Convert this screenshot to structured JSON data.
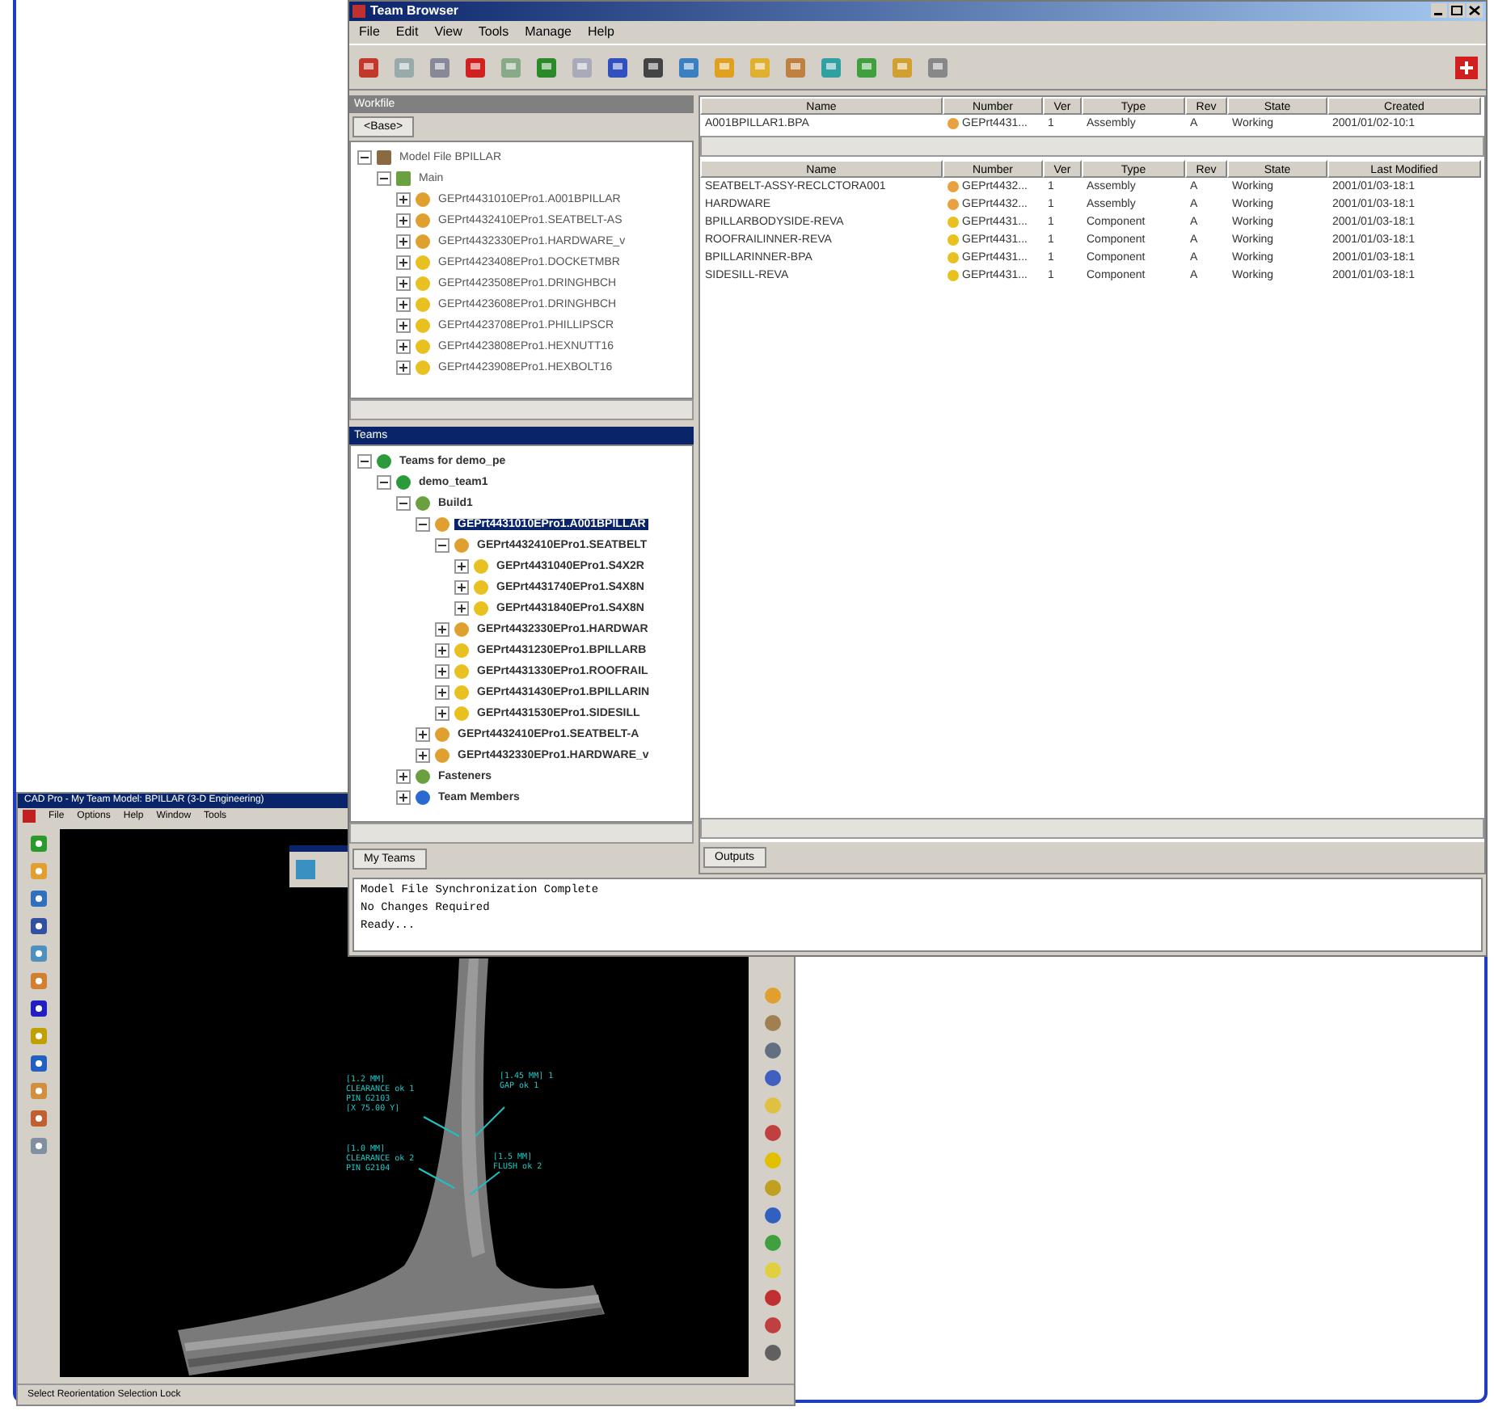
{
  "main_window": {
    "title": "Team Browser",
    "menu": [
      "File",
      "Edit",
      "View",
      "Tools",
      "Manage",
      "Help"
    ],
    "workfile": {
      "header": "Workfile",
      "tab": "<Base>",
      "tree": [
        {
          "label": "Model File BPILLAR",
          "kind": "model",
          "selected": false,
          "children": [
            {
              "label": "Main",
              "kind": "build",
              "selected": false,
              "children": [
                {
                  "label": "GEPrt4431010EPro1.A001BPILLAR",
                  "kind": "assembly",
                  "selected": false
                },
                {
                  "label": "GEPrt4432410EPro1.SEATBELT-AS",
                  "kind": "assembly",
                  "selected": false
                },
                {
                  "label": "GEPrt4432330EPro1.HARDWARE_v",
                  "kind": "assembly",
                  "selected": false
                },
                {
                  "label": "GEPrt4423408EPro1.DOCKETMBR",
                  "kind": "part",
                  "selected": false
                },
                {
                  "label": "GEPrt4423508EPro1.DRINGHBCH",
                  "kind": "part",
                  "selected": false
                },
                {
                  "label": "GEPrt4423608EPro1.DRINGHBCH",
                  "kind": "part",
                  "selected": false
                },
                {
                  "label": "GEPrt4423708EPro1.PHILLIPSCR",
                  "kind": "part",
                  "selected": false
                },
                {
                  "label": "GEPrt4423808EPro1.HEXNUTT16",
                  "kind": "part",
                  "selected": false
                },
                {
                  "label": "GEPrt4423908EPro1.HEXBOLT16",
                  "kind": "part",
                  "selected": false
                }
              ]
            }
          ]
        }
      ]
    },
    "teams": {
      "header": "Teams",
      "tab": "My Teams",
      "tree": [
        {
          "label": "Teams for demo_pe",
          "kind": "team",
          "selected": false,
          "children": [
            {
              "label": "demo_team1",
              "kind": "team",
              "selected": false,
              "children": [
                {
                  "label": "Build1",
                  "kind": "build",
                  "selected": false,
                  "children": [
                    {
                      "label": "GEPrt4431010EPro1.A001BPILLAR",
                      "kind": "assembly",
                      "selected": true,
                      "children": [
                        {
                          "label": "GEPrt4432410EPro1.SEATBELT",
                          "kind": "assembly",
                          "selected": false,
                          "children": [
                            {
                              "label": "GEPrt4431040EPro1.S4X2R",
                              "kind": "part",
                              "selected": false
                            },
                            {
                              "label": "GEPrt4431740EPro1.S4X8N",
                              "kind": "part",
                              "selected": false
                            },
                            {
                              "label": "GEPrt4431840EPro1.S4X8N",
                              "kind": "part",
                              "selected": false
                            }
                          ]
                        },
                        {
                          "label": "GEPrt4432330EPro1.HARDWAR",
                          "kind": "assembly",
                          "selected": false
                        },
                        {
                          "label": "GEPrt4431230EPro1.BPILLARB",
                          "kind": "part",
                          "selected": false
                        },
                        {
                          "label": "GEPrt4431330EPro1.ROOFRAIL",
                          "kind": "part",
                          "selected": false
                        },
                        {
                          "label": "GEPrt4431430EPro1.BPILLARIN",
                          "kind": "part",
                          "selected": false
                        },
                        {
                          "label": "GEPrt4431530EPro1.SIDESILL",
                          "kind": "part",
                          "selected": false
                        }
                      ]
                    },
                    {
                      "label": "GEPrt4432410EPro1.SEATBELT-A",
                      "kind": "assembly",
                      "selected": false
                    },
                    {
                      "label": "GEPrt4432330EPro1.HARDWARE_v",
                      "kind": "assembly",
                      "selected": false
                    }
                  ]
                },
                {
                  "label": "Fasteners",
                  "kind": "build",
                  "selected": false
                },
                {
                  "label": "Team Members",
                  "kind": "members",
                  "selected": false
                }
              ]
            }
          ]
        }
      ]
    },
    "top_table": {
      "columns": [
        "Name",
        "Number",
        "Ver",
        "Type",
        "Rev",
        "State",
        "Created"
      ],
      "rows": [
        [
          "A001BPILLAR1.BPA",
          "GEPrt4431...",
          "1",
          "Assembly",
          "A",
          "Working",
          "2001/01/02-10:1"
        ]
      ]
    },
    "bottom_table": {
      "columns": [
        "Name",
        "Number",
        "Ver",
        "Type",
        "Rev",
        "State",
        "Last Modified"
      ],
      "rows": [
        [
          "SEATBELT-ASSY-RECLCTORA001",
          "GEPrt4432...",
          "1",
          "Assembly",
          "A",
          "Working",
          "2001/01/03-18:1"
        ],
        [
          "HARDWARE",
          "GEPrt4432...",
          "1",
          "Assembly",
          "A",
          "Working",
          "2001/01/03-18:1"
        ],
        [
          "BPILLARBODYSIDE-REVA",
          "GEPrt4431...",
          "1",
          "Component",
          "A",
          "Working",
          "2001/01/03-18:1"
        ],
        [
          "ROOFRAILINNER-REVA",
          "GEPrt4431...",
          "1",
          "Component",
          "A",
          "Working",
          "2001/01/03-18:1"
        ],
        [
          "BPILLARINNER-BPA",
          "GEPrt4431...",
          "1",
          "Component",
          "A",
          "Working",
          "2001/01/03-18:1"
        ],
        [
          "SIDESILL-REVA",
          "GEPrt4431...",
          "1",
          "Component",
          "A",
          "Working",
          "2001/01/03-18:1"
        ]
      ]
    },
    "output_tab": "Outputs",
    "log": [
      "Model File Synchronization Complete",
      "No Changes Required",
      "Ready..."
    ]
  },
  "cad_window": {
    "title": "CAD Pro - My Team Model: BPILLAR (3-D Engineering)",
    "menu": [
      "File",
      "Options",
      "Help",
      "Window",
      "Tools"
    ],
    "annotations": [
      [
        "[1.2 MM]",
        "CLEARANCE ok 1",
        "PIN G2103",
        "[X 75.00 Y]"
      ],
      [
        "[1.45 MM] 1",
        "GAP ok 1"
      ],
      [
        "[1.0 MM]",
        "CLEARANCE ok 2",
        "PIN G2104"
      ],
      [
        "[1.5 MM]",
        "FLUSH ok 2"
      ]
    ],
    "status": "Select  Reorientation  Selection Lock"
  }
}
